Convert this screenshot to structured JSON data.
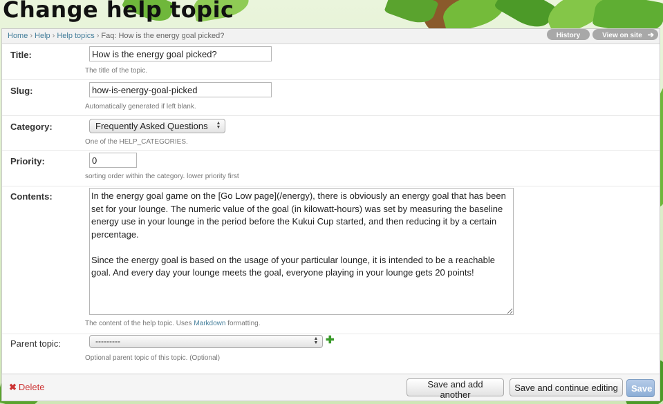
{
  "page": {
    "title": "Change help topic"
  },
  "breadcrumbs": {
    "items": [
      "Home",
      "Help",
      "Help topics"
    ],
    "current": "Faq: How is the energy goal picked?"
  },
  "object_tools": {
    "history": "History",
    "view_on_site": "View on site"
  },
  "form": {
    "title": {
      "label": "Title:",
      "value": "How is the energy goal picked?",
      "help": "The title of the topic."
    },
    "slug": {
      "label": "Slug:",
      "value": "how-is-energy-goal-picked",
      "help": "Automatically generated if left blank."
    },
    "category": {
      "label": "Category:",
      "value": "Frequently Asked Questions",
      "help": "One of the HELP_CATEGORIES."
    },
    "priority": {
      "label": "Priority:",
      "value": "0",
      "help": "sorting order within the category. lower priority first"
    },
    "contents": {
      "label": "Contents:",
      "value": "In the energy goal game on the [Go Low page](/energy), there is obviously an energy goal that has been set for your lounge. The numeric value of the goal (in kilowatt-hours) was set by measuring the baseline energy use in your lounge in the period before the Kukui Cup started, and then reducing it by a certain percentage.\n\nSince the energy goal is based on the usage of your particular lounge, it is intended to be a reachable goal. And every day your lounge meets the goal, everyone playing in your lounge gets 20 points!",
      "help_prefix": "The content of the help topic. Uses ",
      "help_link": "Markdown",
      "help_suffix": " formatting."
    },
    "parent_topic": {
      "label": "Parent topic:",
      "value": "---------",
      "help": "Optional parent topic of this topic. (Optional)"
    }
  },
  "submit": {
    "delete": "Delete",
    "save_add_another": "Save and add another",
    "save_continue": "Save and continue editing",
    "save": "Save"
  },
  "icons": {
    "delete": "x-icon",
    "add": "plus-icon",
    "external": "arrow-right-icon",
    "spinner": "updown-icon"
  }
}
